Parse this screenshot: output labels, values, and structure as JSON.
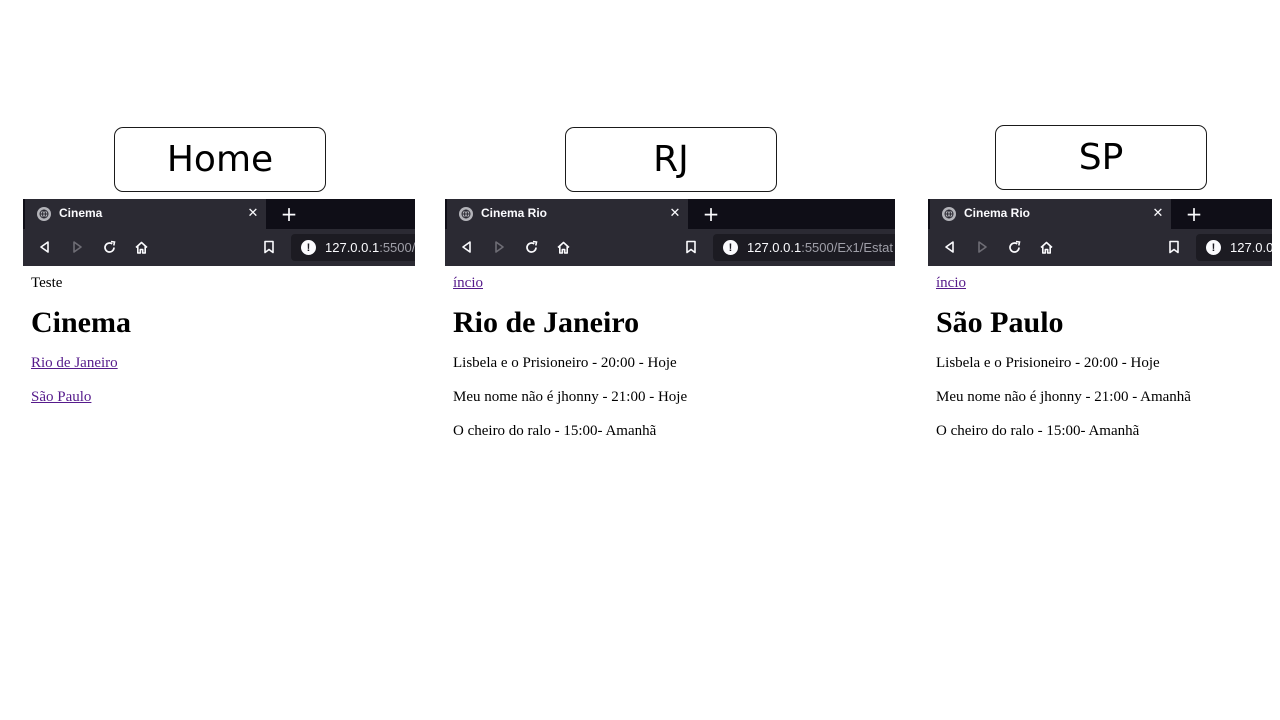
{
  "labels": {
    "home": "Home",
    "rj": "RJ",
    "sp": "SP"
  },
  "colors": {
    "chrome": "#2b2a33",
    "tabstrip": "#0f0e17",
    "visited_link": "#551a8b"
  },
  "icons": [
    "globe-icon",
    "close-icon",
    "plus-icon",
    "back-icon",
    "forward-icon",
    "reload-icon",
    "home-icon",
    "bookmark-icon",
    "info-icon"
  ],
  "home": {
    "tab_title": "Cinema",
    "url_host": "127.0.0.1",
    "url_path": ":5500/",
    "top_text": "Teste",
    "heading": "Cinema",
    "links": [
      "Rio de Janeiro",
      "São Paulo"
    ]
  },
  "rj": {
    "tab_title": "Cinema Rio",
    "url_host": "127.0.0.1",
    "url_path": ":5500/Ex1/Estat",
    "top_link": "íncio",
    "heading": "Rio de Janeiro",
    "sessions": [
      "Lisbela e o Prisioneiro - 20:00 - Hoje",
      "Meu nome não é jhonny - 21:00 - Hoje",
      "O cheiro do ralo - 15:00- Amanhã"
    ]
  },
  "sp": {
    "tab_title": "Cinema Rio",
    "url_host": "127.0.0",
    "url_path": "",
    "top_link": "íncio",
    "heading": "São Paulo",
    "sessions": [
      "Lisbela e o Prisioneiro - 20:00 - Hoje",
      "Meu nome não é jhonny - 21:00 - Amanhã",
      "O cheiro do ralo - 15:00- Amanhã"
    ]
  }
}
